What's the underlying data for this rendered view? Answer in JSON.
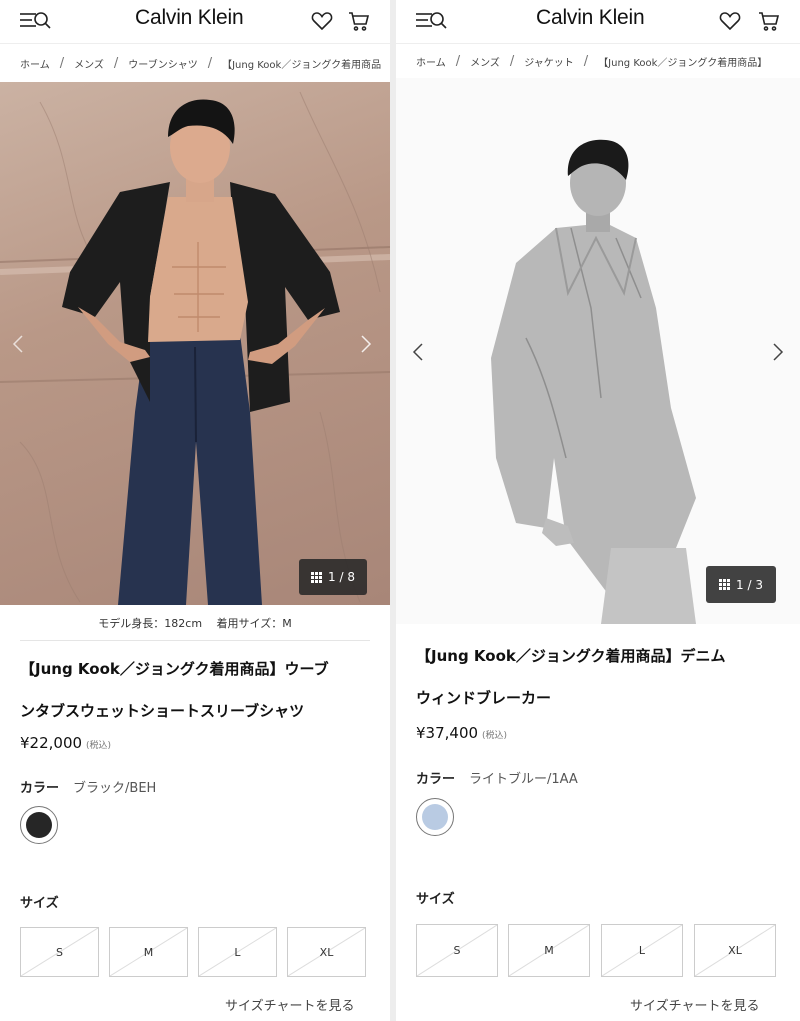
{
  "left": {
    "header": {
      "logo": "Calvin Klein",
      "menu_icon": "menu-search-icon",
      "wishlist_icon": "heart-icon",
      "cart_icon": "cart-icon"
    },
    "breadcrumb": [
      "ホーム",
      "メンズ",
      "ウーブンシャツ",
      "【Jung Kook／ジョングク着用商品"
    ],
    "gallery": {
      "counter": "1 / 8"
    },
    "model_info": "モデル身長：182cm　 着用サイズ：M",
    "product": {
      "name_line1": "【Jung Kook／ジョングク着用商品】ウーブ",
      "name_line2": "ンタブスウェットショートスリーブシャツ",
      "price": "¥22,000",
      "tax_note": "(税込)",
      "color_label": "カラー",
      "color_value": "ブラック/BEH",
      "swatch_color": "#262626"
    },
    "size": {
      "label": "サイズ",
      "options": [
        "S",
        "M",
        "L",
        "XL"
      ],
      "chart_link": "サイズチャートを見る"
    }
  },
  "right": {
    "header": {
      "logo": "Calvin Klein",
      "menu_icon": "menu-search-icon",
      "wishlist_icon": "heart-icon",
      "cart_icon": "cart-icon"
    },
    "breadcrumb": [
      "ホーム",
      "メンズ",
      "ジャケット",
      "【Jung Kook／ジョングク着用商品】"
    ],
    "gallery": {
      "counter": "1 / 3"
    },
    "product": {
      "name_line1": "【Jung Kook／ジョングク着用商品】デニム",
      "name_line2": "ウィンドブレーカー",
      "price": "¥37,400",
      "tax_note": "(税込)",
      "color_label": "カラー",
      "color_value": "ライトブルー/1AA",
      "swatch_color": "#b9cbe3"
    },
    "size": {
      "label": "サイズ",
      "options": [
        "S",
        "M",
        "L",
        "XL"
      ],
      "chart_link": "サイズチャートを見る"
    }
  }
}
